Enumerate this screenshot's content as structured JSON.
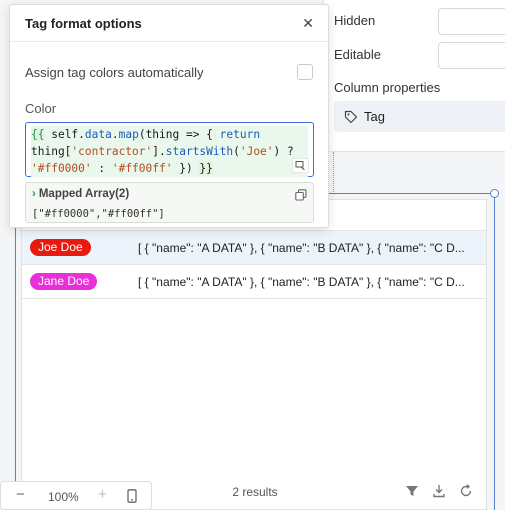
{
  "popover": {
    "title": "Tag format options",
    "close_icon": "close-icon",
    "assign_label": "Assign tag colors automatically",
    "color_label": "Color",
    "code": {
      "open": "{{",
      "line1_self": " self.",
      "line1_data": "data",
      "line1_dot": ".",
      "line1_map": "map",
      "line1_rest": "(thing => { ",
      "line1_return": "return",
      "line2_a": "thing[",
      "line2_str": "'contractor'",
      "line2_b": "].",
      "line2_method": "startsWith",
      "line2_c": "(",
      "line2_joe": "'Joe'",
      "line2_d": ") ?",
      "line3_red": "'#ff0000'",
      "line3_colon": " : ",
      "line3_mag": "'#ff00ff'",
      "line3_end": " }) ",
      "close": "}}"
    },
    "eval": {
      "title": "Mapped Array(2)",
      "value": "[\"#ff0000\",\"#ff00ff\"]"
    }
  },
  "properties": {
    "hidden_label": "Hidden",
    "editable_label": "Editable",
    "column_properties_label": "Column properties",
    "column_tag_label": "Tag"
  },
  "table": {
    "rows": [
      {
        "name": "Joe Doe",
        "color": "#e8190f",
        "data": "[ { \"name\": \"A DATA\" }, { \"name\": \"B DATA\" }, { \"name\": \"C D..."
      },
      {
        "name": "Jane Doe",
        "color": "#e82fd9",
        "data": "[ { \"name\": \"A DATA\" }, { \"name\": \"B DATA\" }, { \"name\": \"C D..."
      }
    ],
    "results": "2 results"
  },
  "zoom": {
    "minus": "−",
    "level": "100%",
    "plus": "+"
  },
  "colors": {
    "accent": "#3f6fd8",
    "selection": "#5b7fd6"
  }
}
